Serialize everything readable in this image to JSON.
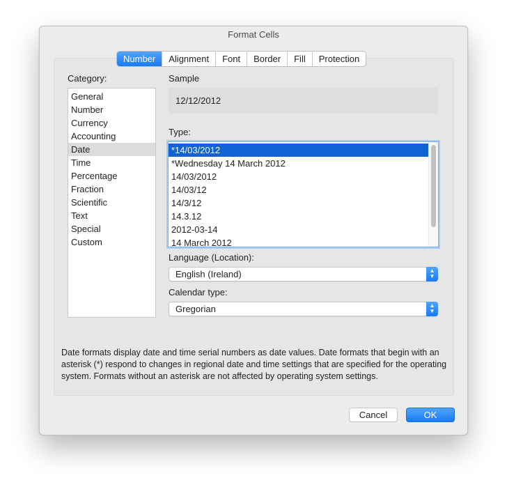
{
  "window": {
    "title": "Format Cells"
  },
  "tabs": [
    {
      "label": "Number",
      "active": true
    },
    {
      "label": "Alignment",
      "active": false
    },
    {
      "label": "Font",
      "active": false
    },
    {
      "label": "Border",
      "active": false
    },
    {
      "label": "Fill",
      "active": false
    },
    {
      "label": "Protection",
      "active": false
    }
  ],
  "category": {
    "label": "Category:",
    "selected": "Date",
    "items": [
      "General",
      "Number",
      "Currency",
      "Accounting",
      "Date",
      "Time",
      "Percentage",
      "Fraction",
      "Scientific",
      "Text",
      "Special",
      "Custom"
    ]
  },
  "sample": {
    "label": "Sample",
    "value": "12/12/2012"
  },
  "type": {
    "label": "Type:",
    "selected": "*14/03/2012",
    "items": [
      "*14/03/2012",
      "*Wednesday 14 March 2012",
      "14/03/2012",
      "14/03/12",
      "14/3/12",
      "14.3.12",
      "2012-03-14",
      "14 March 2012"
    ]
  },
  "language": {
    "label": "Language (Location):",
    "value": "English (Ireland)"
  },
  "calendar": {
    "label": "Calendar type:",
    "value": "Gregorian"
  },
  "description": "Date formats display date and time serial numbers as date values.  Date formats that begin with an asterisk (*) respond to changes in regional date and time settings that are specified for the operating system. Formats without an asterisk are not affected by operating system settings.",
  "buttons": {
    "cancel": "Cancel",
    "ok": "OK"
  },
  "colors": {
    "accent": "#1a7af5",
    "selection": "#0f63d3"
  }
}
